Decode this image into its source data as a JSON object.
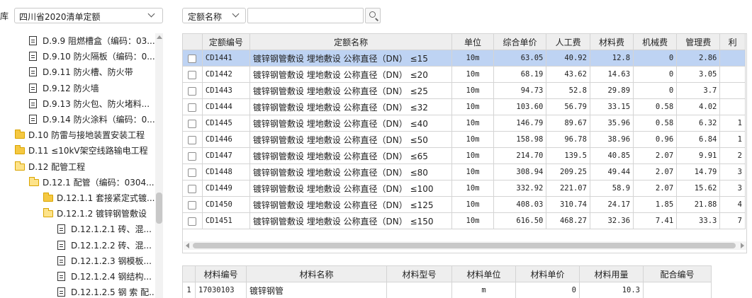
{
  "library": {
    "label": "库",
    "selected": "四川省2020清单定额"
  },
  "tree": [
    {
      "label": "D.9.9 阻燃槽盒（编码：03...",
      "type": "doc",
      "indent": 41
    },
    {
      "label": "D.9.10 防火隔板（编码：0...",
      "type": "doc",
      "indent": 41
    },
    {
      "label": "D.9.11 防火槽、防火带",
      "type": "doc",
      "indent": 41
    },
    {
      "label": "D.9.12 防火墙",
      "type": "doc",
      "indent": 41
    },
    {
      "label": "D.9.13 防火包、防火堵料...",
      "type": "doc",
      "indent": 41
    },
    {
      "label": "D.9.14 防火涂料（编码：0...",
      "type": "doc",
      "indent": 41
    },
    {
      "label": "D.10 防雷与接地装置安装工程",
      "type": "folder",
      "indent": 21
    },
    {
      "label": "D.11 ≤10kV架空线路输电工程",
      "type": "folder",
      "indent": 21
    },
    {
      "label": "D.12 配管工程",
      "type": "folder-open",
      "indent": 21
    },
    {
      "label": "D.12.1 配管（编码：0304...",
      "type": "folder-open",
      "indent": 41
    },
    {
      "label": "D.12.1.1 套接紧定式镀...",
      "type": "folder",
      "indent": 61
    },
    {
      "label": "D.12.1.2 镀锌钢管敷设",
      "type": "folder-open",
      "indent": 61
    },
    {
      "label": "D.12.1.2.1 砖、混...",
      "type": "doc",
      "indent": 81
    },
    {
      "label": "D.12.1.2.2 砖、混...",
      "type": "doc",
      "indent": 81
    },
    {
      "label": "D.12.1.2.3 钢模板...",
      "type": "doc",
      "indent": 81
    },
    {
      "label": "D.12.1.2.4 钢结构...",
      "type": "doc",
      "indent": 81
    },
    {
      "label": "D.12.1.2.5 钢 索 配...",
      "type": "doc",
      "indent": 81
    }
  ],
  "search": {
    "field": "定额名称",
    "value": ""
  },
  "main_table": {
    "headers": [
      "定额编号",
      "定额名称",
      "单位",
      "综合单价",
      "人工费",
      "材料费",
      "机械费",
      "管理费",
      "利"
    ],
    "rows": [
      [
        "CD1441",
        "镀锌钢管敷设 埋地敷设 公称直径（DN） ≤15",
        "10m",
        "63.05",
        "40.92",
        "12.8",
        "0",
        "2.86",
        ""
      ],
      [
        "CD1442",
        "镀锌钢管敷设 埋地敷设 公称直径（DN） ≤20",
        "10m",
        "68.19",
        "43.62",
        "14.63",
        "0",
        "3.05",
        ""
      ],
      [
        "CD1443",
        "镀锌钢管敷设 埋地敷设 公称直径（DN） ≤25",
        "10m",
        "94.73",
        "52.8",
        "29.89",
        "0",
        "3.7",
        ""
      ],
      [
        "CD1444",
        "镀锌钢管敷设 埋地敷设 公称直径（DN） ≤32",
        "10m",
        "103.60",
        "56.79",
        "33.15",
        "0.58",
        "4.02",
        ""
      ],
      [
        "CD1445",
        "镀锌钢管敷设 埋地敷设 公称直径（DN） ≤40",
        "10m",
        "146.79",
        "89.67",
        "35.96",
        "0.58",
        "6.32",
        "1"
      ],
      [
        "CD1446",
        "镀锌钢管敷设 埋地敷设 公称直径（DN） ≤50",
        "10m",
        "158.98",
        "96.78",
        "38.96",
        "0.96",
        "6.84",
        "1"
      ],
      [
        "CD1447",
        "镀锌钢管敷设 埋地敷设 公称直径（DN） ≤65",
        "10m",
        "214.70",
        "139.5",
        "40.85",
        "2.07",
        "9.91",
        "2"
      ],
      [
        "CD1448",
        "镀锌钢管敷设 埋地敷设 公称直径（DN） ≤80",
        "10m",
        "308.94",
        "209.25",
        "49.44",
        "2.07",
        "14.79",
        "3"
      ],
      [
        "CD1449",
        "镀锌钢管敷设 埋地敷设 公称直径（DN） ≤100",
        "10m",
        "332.92",
        "221.07",
        "58.9",
        "2.07",
        "15.62",
        "3"
      ],
      [
        "CD1450",
        "镀锌钢管敷设 埋地敷设 公称直径（DN） ≤125",
        "10m",
        "408.03",
        "310.74",
        "24.17",
        "1.85",
        "21.88",
        "4"
      ],
      [
        "CD1451",
        "镀锌钢管敷设 埋地敷设 公称直径（DN） ≤150",
        "10m",
        "616.50",
        "468.27",
        "32.36",
        "7.41",
        "33.3",
        "7"
      ]
    ],
    "selected_index": 0
  },
  "material_table": {
    "headers": [
      "材料编号",
      "材料名称",
      "材料型号",
      "材料单位",
      "材料单价",
      "材料用量",
      "配合编号"
    ],
    "rows": [
      [
        "1",
        "17030103",
        "镀锌钢管",
        "",
        "m",
        "0",
        "10.3",
        ""
      ]
    ]
  }
}
